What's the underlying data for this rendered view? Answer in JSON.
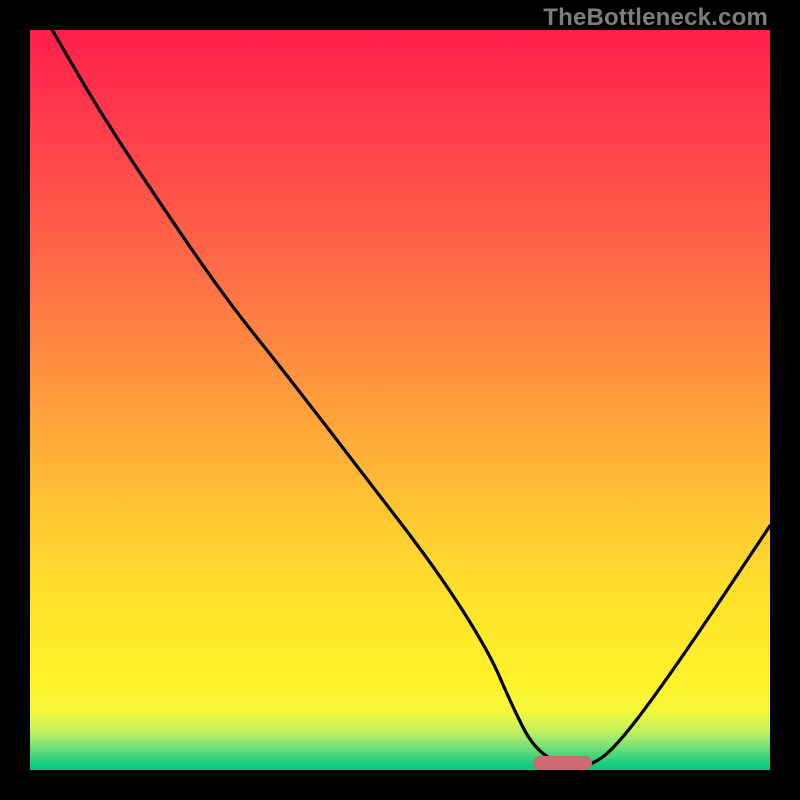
{
  "watermark": "TheBottleneck.com",
  "colors": {
    "background": "#000000",
    "marker": "#cc6b72",
    "curve": "#000000"
  },
  "chart_data": {
    "type": "line",
    "title": "",
    "xlabel": "",
    "ylabel": "",
    "x_range": [
      0,
      100
    ],
    "y_range": [
      0,
      100
    ],
    "series": [
      {
        "name": "bottleneck-curve",
        "x": [
          3,
          10,
          20,
          27,
          35,
          45,
          55,
          62,
          65,
          68,
          72,
          76,
          80,
          88,
          100
        ],
        "y": [
          100,
          88,
          73,
          63,
          53,
          40,
          27,
          16,
          9,
          3,
          0.5,
          0.5,
          4,
          15,
          33
        ]
      }
    ],
    "marker_range_x": [
      68,
      76
    ],
    "grid": false,
    "legend": false
  }
}
